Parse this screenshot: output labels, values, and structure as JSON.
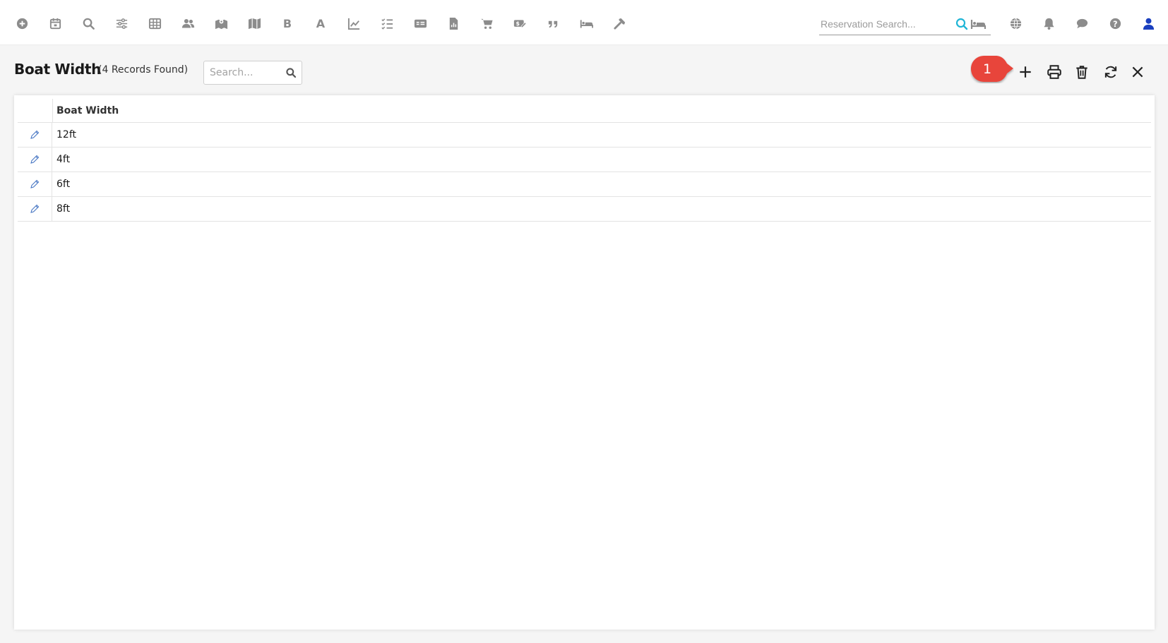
{
  "toolbar": {
    "icons": [
      "add-circle-icon",
      "calendar-icon",
      "search-icon",
      "filters-icon",
      "table-icon",
      "users-icon",
      "map-marker-icon",
      "map-icon",
      "bold-b-icon",
      "letter-a-icon",
      "line-chart-icon",
      "checklist-icon",
      "card-icon",
      "report-icon",
      "cart-icon",
      "payment-icon",
      "quote-icon",
      "bed-icon",
      "tools-icon"
    ],
    "bold_letter": "B",
    "a_letter": "A",
    "reservation_search": {
      "placeholder": "Reservation Search..."
    },
    "right_icons": [
      "globe-icon",
      "bell-icon",
      "chat-icon",
      "help-icon",
      "user-icon"
    ]
  },
  "page": {
    "title": "Boat Width",
    "record_count": "(4 Records Found)",
    "search": {
      "placeholder": "Search...",
      "value": ""
    }
  },
  "actions": [
    "add-icon",
    "print-icon",
    "delete-icon",
    "refresh-icon",
    "close-icon"
  ],
  "callout": {
    "number": "1",
    "color": "#e8443a"
  },
  "grid": {
    "columns": [
      "Boat Width"
    ],
    "rows": [
      {
        "value": "12ft"
      },
      {
        "value": "4ft"
      },
      {
        "value": "6ft"
      },
      {
        "value": "8ft"
      }
    ]
  },
  "colors": {
    "accent": "#1fb5d6",
    "user": "#1a3fbf",
    "edit": "#4a78c4",
    "callout": "#e8443a"
  }
}
